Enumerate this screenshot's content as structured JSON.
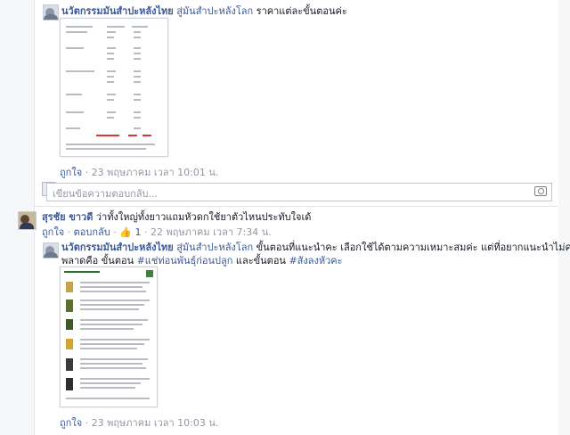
{
  "comment1": {
    "author": "นวัตกรรมมันสำปะหลังไทย",
    "tag": "สู่มันสำปะหลังโลก",
    "text": "ราคาแต่ละขั้นตอนค่ะ",
    "like": "ถูกใจ",
    "time": "23 พฤษภาคม เวลา 10:01 น."
  },
  "reply_box": {
    "placeholder": "เขียนข้อความตอบกลับ..."
  },
  "comment2": {
    "author": "สุรชัย ขาวดี",
    "text": "ว่าทั้งใหญ่ทั้งยาวแถมหัวดกใช้ยาตัวไหนประทับใจเด้",
    "like": "ถูกใจ",
    "reply": "ตอบกลับ",
    "like_count": "1",
    "time": "22 พฤษภาคม เวลา 7:34 น."
  },
  "comment3": {
    "author": "นวัตกรรมมันสำปะหลังไทย",
    "tag": "สู่มันสำปะหลังโลก",
    "text1": "ขั้นตอนที่แนะนำคะ เลือกใช้ได้ตามความเหมาะสมค่ะ แต่ที่อยากแนะนำไม่ควร",
    "text2_a": "พลาดคือ ขั้นตอน",
    "hashtag1": "#แช่ท่อนพันธุ์ก่อนปลูก",
    "text2_b": "และขั้นตอน",
    "hashtag2": "#สังลงหัวคะ",
    "like": "ถูกใจ",
    "time": "23 พฤษภาคม เวลา 10:03 น."
  },
  "icons": {
    "avatar": "page-avatar",
    "camera": "camera-icon",
    "thumb": "thumbs-up-icon"
  }
}
